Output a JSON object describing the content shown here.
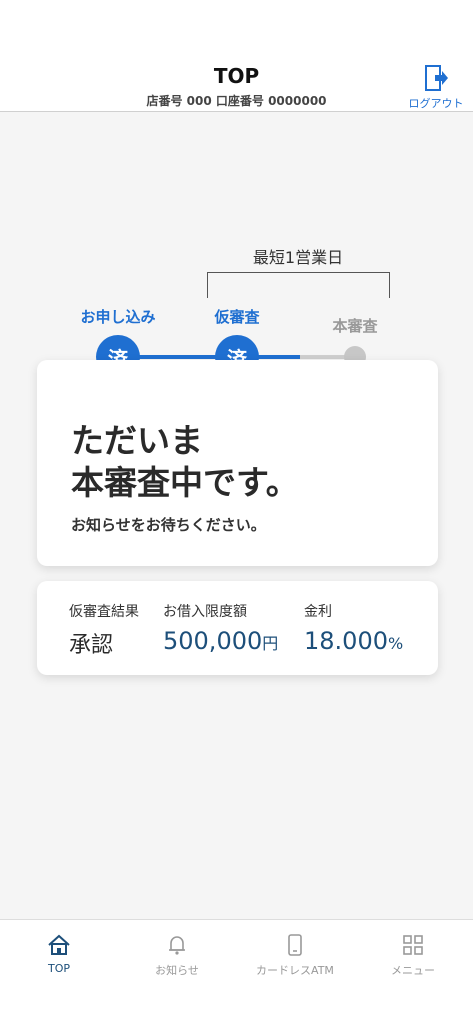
{
  "header": {
    "title": "TOP",
    "subtitle": "店番号 000 口座番号 0000000",
    "logout_label": "ログアウト"
  },
  "progress": {
    "fast_label": "最短1営業日",
    "steps": [
      {
        "label": "お申し込み",
        "mark": "済",
        "status": "done"
      },
      {
        "label": "仮審査",
        "mark": "済",
        "status": "done"
      },
      {
        "label": "本審査",
        "mark": "",
        "status": "pending"
      }
    ]
  },
  "status_card": {
    "line1": "ただいま",
    "line2": "本審査中です。",
    "note": "お知らせをお待ちください。"
  },
  "info_card": {
    "result_label": "仮審査結果",
    "result_value": "承認",
    "limit_label": "お借入限度額",
    "limit_value": "500,000",
    "limit_unit": "円",
    "rate_label": "金利",
    "rate_value": "18.000",
    "rate_unit": "%"
  },
  "tabbar": {
    "items": [
      {
        "label": "TOP",
        "icon": "home-icon",
        "active": true
      },
      {
        "label": "お知らせ",
        "icon": "bell-icon",
        "active": false
      },
      {
        "label": "カードレスATM",
        "icon": "phone-icon",
        "active": false
      },
      {
        "label": "メニュー",
        "icon": "grid-icon",
        "active": false
      }
    ]
  },
  "colors": {
    "accent": "#1f6fd1",
    "navy": "#1d4f7a",
    "inactive": "#999999"
  }
}
